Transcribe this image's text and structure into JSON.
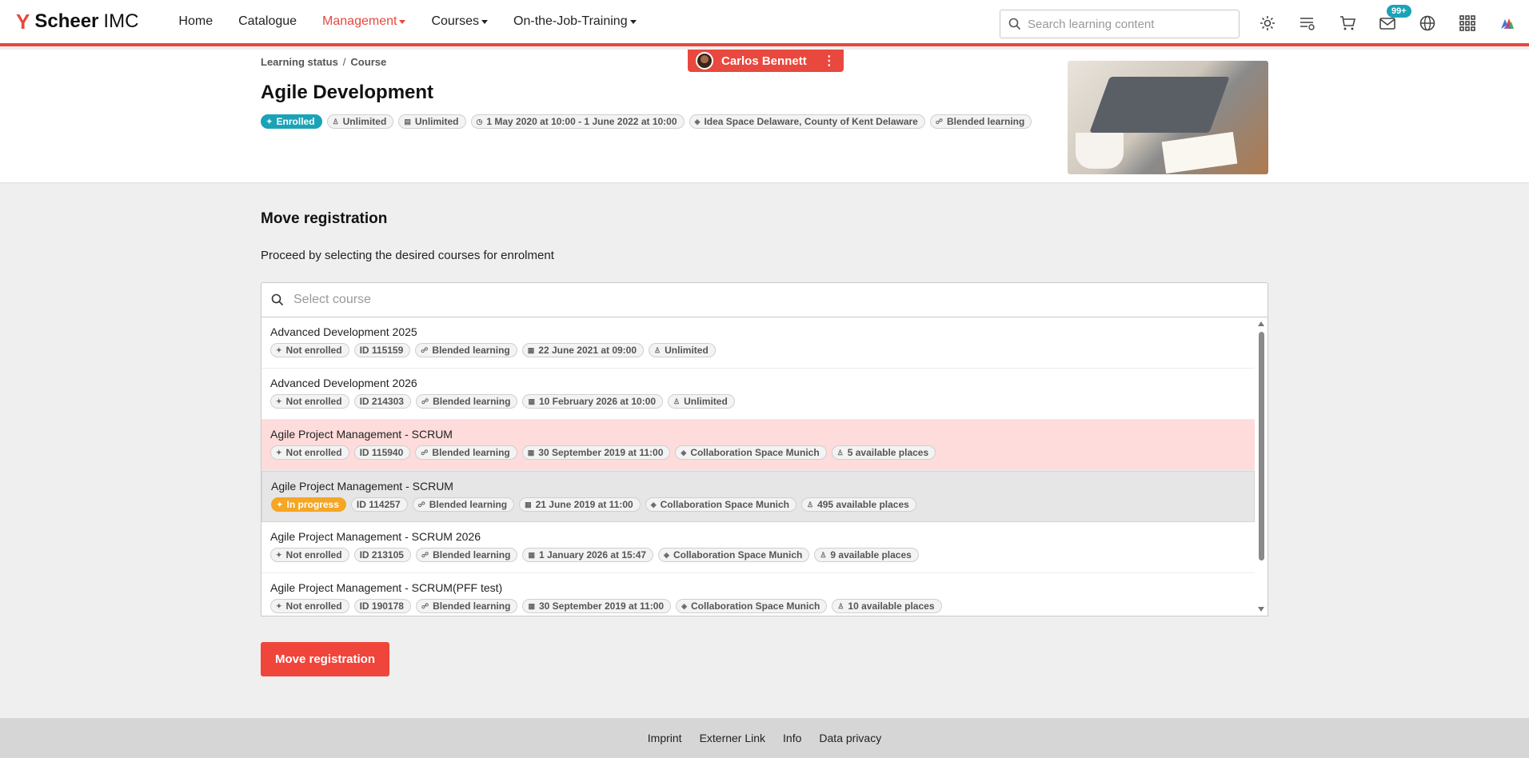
{
  "brand": {
    "name_bold": "Scheer",
    "name_light": "IMC",
    "accent": "#e8483e"
  },
  "nav": [
    {
      "label": "Home",
      "dropdown": false,
      "active": false
    },
    {
      "label": "Catalogue",
      "dropdown": false,
      "active": false
    },
    {
      "label": "Management",
      "dropdown": true,
      "active": true
    },
    {
      "label": "Courses",
      "dropdown": true,
      "active": false
    },
    {
      "label": "On-the-Job-Training",
      "dropdown": true,
      "active": false
    }
  ],
  "search": {
    "placeholder": "Search learning content"
  },
  "top_icons": [
    "gear-icon",
    "learning-list-icon",
    "cart-icon",
    "mail-icon",
    "globe-icon",
    "apps-grid-icon",
    "brand-icon"
  ],
  "mail_badge": "99+",
  "breadcrumb": [
    "Learning status",
    "Course"
  ],
  "user": {
    "name": "Carlos Bennett"
  },
  "course": {
    "title": "Agile Development",
    "chips": [
      {
        "icon": "enrolled-icon",
        "label": "Enrolled",
        "variant": "enrolled"
      },
      {
        "icon": "seat-icon",
        "label": "Unlimited"
      },
      {
        "icon": "duration-icon",
        "label": "Unlimited"
      },
      {
        "icon": "clock-icon",
        "label": "1 May 2020 at 10:00 - 1 June 2022 at 10:00"
      },
      {
        "icon": "location-icon",
        "label": "Idea Space Delaware, County of Kent Delaware"
      },
      {
        "icon": "blended-icon",
        "label": "Blended learning"
      }
    ]
  },
  "main": {
    "section_title": "Move registration",
    "subtitle": "Proceed by selecting the desired courses for enrolment",
    "select_placeholder": "Select course",
    "button_label": "Move registration"
  },
  "courses": [
    {
      "title": "Advanced Development 2025",
      "state": "default",
      "chips": [
        {
          "icon": "status-icon",
          "label": "Not enrolled"
        },
        {
          "icon": "",
          "label": "ID 115159"
        },
        {
          "icon": "blended-icon",
          "label": "Blended learning"
        },
        {
          "icon": "calendar-icon",
          "label": "22 June 2021 at 09:00"
        },
        {
          "icon": "seat-icon",
          "label": "Unlimited"
        }
      ]
    },
    {
      "title": "Advanced Development 2026",
      "state": "default",
      "chips": [
        {
          "icon": "status-icon",
          "label": "Not enrolled"
        },
        {
          "icon": "",
          "label": "ID 214303"
        },
        {
          "icon": "blended-icon",
          "label": "Blended learning"
        },
        {
          "icon": "calendar-icon",
          "label": "10 February 2026 at 10:00"
        },
        {
          "icon": "seat-icon",
          "label": "Unlimited"
        }
      ]
    },
    {
      "title": "Agile Project Management - SCRUM",
      "state": "hover",
      "chips": [
        {
          "icon": "status-icon",
          "label": "Not enrolled"
        },
        {
          "icon": "",
          "label": "ID 115940"
        },
        {
          "icon": "blended-icon",
          "label": "Blended learning"
        },
        {
          "icon": "calendar-icon",
          "label": "30 September 2019 at 11:00"
        },
        {
          "icon": "location-icon",
          "label": "Collaboration Space Munich"
        },
        {
          "icon": "seat-icon",
          "label": "5 available places"
        }
      ]
    },
    {
      "title": "Agile Project Management - SCRUM",
      "state": "selected",
      "chips": [
        {
          "icon": "status-icon",
          "label": "In progress",
          "variant": "inprogress"
        },
        {
          "icon": "",
          "label": "ID 114257"
        },
        {
          "icon": "blended-icon",
          "label": "Blended learning"
        },
        {
          "icon": "calendar-icon",
          "label": "21 June 2019 at 11:00"
        },
        {
          "icon": "location-icon",
          "label": "Collaboration Space Munich"
        },
        {
          "icon": "seat-icon",
          "label": "495 available places"
        }
      ]
    },
    {
      "title": "Agile Project Management - SCRUM 2026",
      "state": "default",
      "chips": [
        {
          "icon": "status-icon",
          "label": "Not enrolled"
        },
        {
          "icon": "",
          "label": "ID 213105"
        },
        {
          "icon": "blended-icon",
          "label": "Blended learning"
        },
        {
          "icon": "calendar-icon",
          "label": "1 January 2026 at 15:47"
        },
        {
          "icon": "location-icon",
          "label": "Collaboration Space Munich"
        },
        {
          "icon": "seat-icon",
          "label": "9 available places"
        }
      ]
    },
    {
      "title": "Agile Project Management - SCRUM(PFF test)",
      "state": "default",
      "chips": [
        {
          "icon": "status-icon",
          "label": "Not enrolled"
        },
        {
          "icon": "",
          "label": "ID 190178"
        },
        {
          "icon": "blended-icon",
          "label": "Blended learning"
        },
        {
          "icon": "calendar-icon",
          "label": "30 September 2019 at 11:00"
        },
        {
          "icon": "location-icon",
          "label": "Collaboration Space Munich"
        },
        {
          "icon": "seat-icon",
          "label": "10 available places"
        }
      ]
    }
  ],
  "footer": [
    "Imprint",
    "Externer Link",
    "Info",
    "Data privacy"
  ]
}
